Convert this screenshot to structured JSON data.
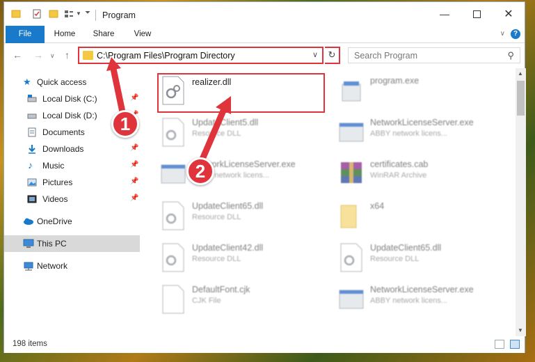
{
  "window": {
    "title": "Program"
  },
  "ribbon": {
    "tabs": [
      "File",
      "Home",
      "Share",
      "View"
    ],
    "help": "?"
  },
  "address": {
    "path": "C:\\Program Files\\Program Directory"
  },
  "search": {
    "placeholder": "Search Program"
  },
  "sidebar": {
    "items": [
      {
        "label": "Quick access",
        "icon": "star-icon"
      },
      {
        "label": "Local Disk (C:)",
        "icon": "drive-icon",
        "pinned": true
      },
      {
        "label": "Local Disk (D:)",
        "icon": "drive-icon",
        "pinned": true
      },
      {
        "label": "Documents",
        "icon": "documents-icon",
        "pinned": true
      },
      {
        "label": "Downloads",
        "icon": "download-icon",
        "pinned": true
      },
      {
        "label": "Music",
        "icon": "music-icon",
        "pinned": true
      },
      {
        "label": "Pictures",
        "icon": "pictures-icon",
        "pinned": true
      },
      {
        "label": "Videos",
        "icon": "videos-icon",
        "pinned": true
      },
      {
        "label": "OneDrive",
        "icon": "cloud-icon"
      },
      {
        "label": "This PC",
        "icon": "computer-icon",
        "selected": true
      },
      {
        "label": "Network",
        "icon": "network-icon"
      }
    ]
  },
  "files": [
    {
      "name": "realizer.dll",
      "type": "",
      "icon": "dll-icon"
    },
    {
      "name": "program.exe",
      "type": "",
      "icon": "exe-icon"
    },
    {
      "name": "UpdateClient5.dll",
      "type": "Resource DLL",
      "icon": "dll-icon"
    },
    {
      "name": "NetworkLicenseServer.exe",
      "type": "ABBY network licens...",
      "icon": "exe-icon"
    },
    {
      "name": "NetworkLicenseServer.exe",
      "type": "ABBY network licens...",
      "icon": "exe-icon"
    },
    {
      "name": "certificates.cab",
      "type": "WinRAR Archive",
      "icon": "archive-icon"
    },
    {
      "name": "UpdateClient65.dll",
      "type": "Resource DLL",
      "icon": "dll-icon"
    },
    {
      "name": "x64",
      "type": "",
      "icon": "folder-icon"
    },
    {
      "name": "UpdateClient42.dll",
      "type": "Resource DLL",
      "icon": "dll-icon"
    },
    {
      "name": "UpdateClient65.dll",
      "type": "Resource DLL",
      "icon": "dll-icon"
    },
    {
      "name": "DefaultFont.cjk",
      "type": "CJK File",
      "icon": "file-icon"
    },
    {
      "name": "NetworkLicenseServer.exe",
      "type": "ABBY network licens...",
      "icon": "exe-icon"
    }
  ],
  "status": {
    "count": "198 items"
  },
  "callouts": {
    "one": "1",
    "two": "2"
  }
}
